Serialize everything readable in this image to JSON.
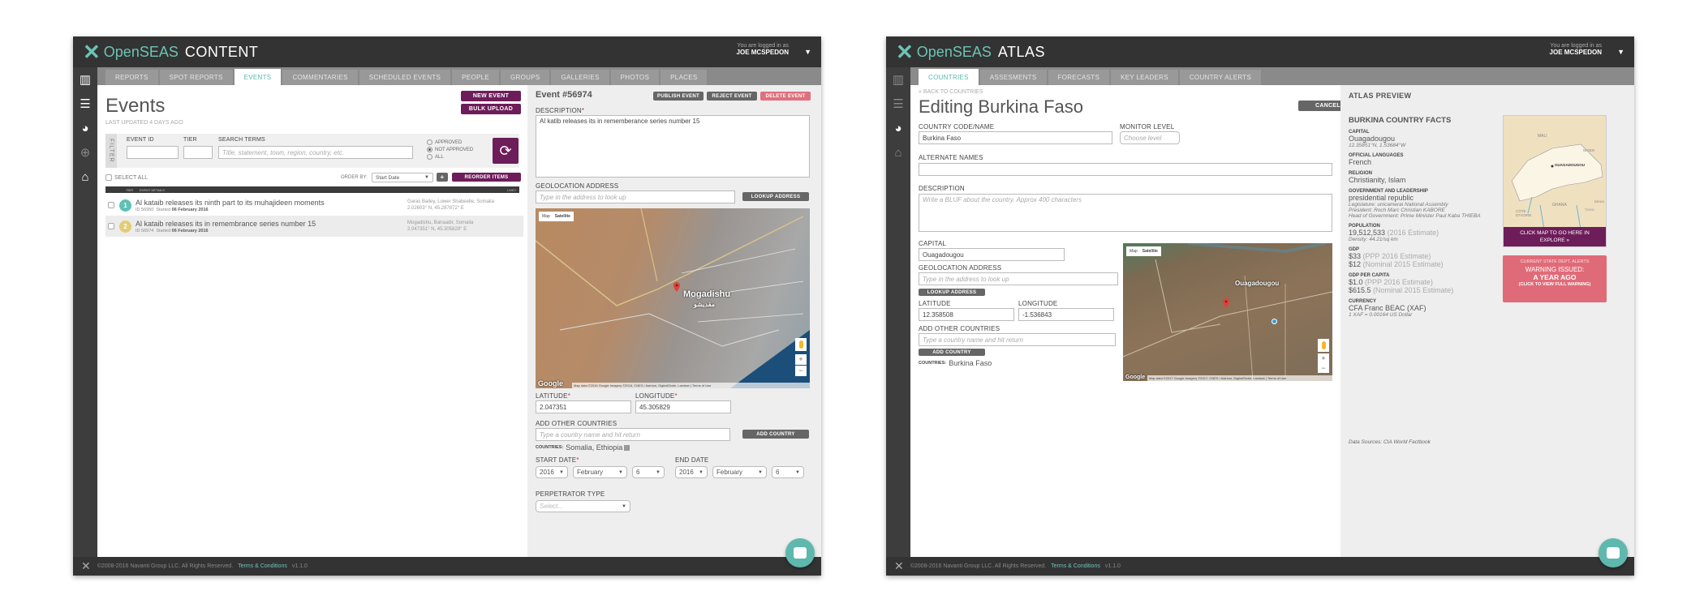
{
  "content_app": {
    "logo_brand": "OpenSEAS",
    "app_name": "CONTENT",
    "user": {
      "logged_in_label": "You are logged in as",
      "name": "JOE MCSPEDON"
    },
    "tabs": [
      "REPORTS",
      "SPOT REPORTS",
      "EVENTS",
      "COMMENTARIES",
      "SCHEDULED EVENTS",
      "PEOPLE",
      "GROUPS",
      "GALLERIES",
      "PHOTOS",
      "PLACES"
    ],
    "active_tab": "EVENTS",
    "page_title": "Events",
    "last_updated": "LAST UPDATED 4 DAYS AGO",
    "buttons": {
      "new_event": "NEW EVENT",
      "bulk_upload": "BULK UPLOAD",
      "reorder": "REORDER ITEMS",
      "plus": "+"
    },
    "filter": {
      "tab_label": "FILTER",
      "event_id_label": "EVENT ID",
      "tier_label": "TIER",
      "search_label": "SEARCH TERMS",
      "search_placeholder": "Title, statement, town, region, country, etc.",
      "radios": [
        {
          "label": "APPROVED",
          "selected": false
        },
        {
          "label": "NOT APPROVED",
          "selected": true
        },
        {
          "label": "ALL",
          "selected": false
        }
      ]
    },
    "select_all": "SELECT ALL",
    "order_by_label": "ORDER BY:",
    "order_by_value": "Start Date",
    "list_headers": {
      "tier": "TIER",
      "details": "EVENT DETAILS",
      "live": "LIVE?"
    },
    "events": [
      {
        "tier": "1",
        "tier_color": "#5fc0b4",
        "title": "Al kataib releases its ninth part to its muhajideen moments",
        "id": "ID 56950",
        "started_label": "Started",
        "started": "06 February 2016",
        "location": "Garas Balley, Lower Shabeelle, Somalia",
        "coords": "2.02603° N, 45.287872° E"
      },
      {
        "tier": "2",
        "tier_color": "#e3cc74",
        "title": "Al kataib releases its in remembrance series number 15",
        "id": "ID 56974",
        "started_label": "Started",
        "started": "06 February 2016",
        "location": "Mogadishu, Banaadir, Somalia",
        "coords": "2.047351° N, 45.305829° E"
      }
    ],
    "detail": {
      "title": "Event #56974",
      "publish": "PUBLISH EVENT",
      "reject": "REJECT EVENT",
      "delete": "DELETE EVENT",
      "description_label": "DESCRIPTION",
      "description": "Al katib releases its in rememberance series number 15",
      "geo_label": "GEOLOCATION ADDRESS",
      "geo_placeholder": "Type in the address to look up",
      "lookup": "LOOKUP ADDRESS",
      "map": {
        "tab_map": "Map",
        "tab_satellite": "Satellite",
        "city": "Mogadishu",
        "city_sub": "مقديشو",
        "attribution": "Map data ©2016 Google Imagery ©2016, CNES / Astrium, DigitalGlobe, Landsat | Terms of Use",
        "google": "Google"
      },
      "lat_label": "LATITUDE",
      "lat": "2.047351",
      "lng_label": "LONGITUDE",
      "lng": "45.305829",
      "add_countries_label": "ADD OTHER COUNTRIES",
      "add_countries_placeholder": "Type a country name and hit return",
      "add_country": "ADD COUNTRY",
      "countries_label": "COUNTRIES:",
      "countries": "Somalia, Ethiopia",
      "start_label": "START DATE",
      "end_label": "END DATE",
      "start": {
        "year": "2016",
        "month": "February",
        "day": "6"
      },
      "end": {
        "year": "2016",
        "month": "February",
        "day": "6"
      },
      "perp_label": "PERPETRATOR TYPE",
      "perp_placeholder": "Select..."
    },
    "footer": {
      "copyright": "©2008-2016 Navanti Group LLC. All Rights Reserved.",
      "terms": "Terms & Conditions",
      "version": "v1.1.0"
    }
  },
  "atlas_app": {
    "logo_brand": "OpenSEAS",
    "app_name": "ATLAS",
    "user": {
      "logged_in_label": "You are logged in as",
      "name": "JOE MCSPEDON"
    },
    "tabs": [
      "COUNTRIES",
      "ASSESMENTS",
      "FORECASTS",
      "KEY LEADERS",
      "COUNTRY ALERTS"
    ],
    "active_tab": "COUNTRIES",
    "back_link": "« BACK TO COUNTRIES",
    "page_title": "Editing Burkina Faso",
    "cancel": "CANCEL",
    "form": {
      "code_label": "COUNTRY CODE/NAME",
      "code_value": "Burkina Faso",
      "monitor_label": "MONITOR LEVEL",
      "monitor_placeholder": "Choose level",
      "alt_label": "ALTERNATE NAMES",
      "alt_value": "",
      "desc_label": "DESCRIPTION",
      "desc_placeholder": "Write a BLUF about the country. Approx 400 characters",
      "capital_label": "CAPITAL",
      "capital_value": "Ouagadougou",
      "geo_label": "GEOLOCATION ADDRESS",
      "geo_placeholder": "Type in the address to look up",
      "lookup": "LOOKUP ADDRESS",
      "lat_label": "LATITUDE",
      "lat": "12.358508",
      "lng_label": "LONGITUDE",
      "lng": "-1.536843",
      "add_countries_label": "ADD OTHER COUNTRIES",
      "add_countries_placeholder": "Type a country name and hit return",
      "add_country": "ADD COUNTRY",
      "countries_label": "COUNTRIES:",
      "countries": "Burkina Faso",
      "map": {
        "tab_map": "Map",
        "tab_satellite": "Satellite",
        "city": "Ouagadougou",
        "google": "Google",
        "attribution": "Map data ©2017 Google Imagery ©2017, CNES / Astrium, DigitalGlobe, Landsat | Terms of Use"
      }
    },
    "preview": {
      "heading": "ATLAS PREVIEW",
      "facts_title": "BURKINA COUNTRY FACTS",
      "capital_label": "CAPITAL",
      "capital": "Ouagadougou",
      "capital_coords": "12.35851°N, 1.53684°W",
      "languages_label": "OFFICIAL LANGUAGES",
      "languages": "French",
      "religion_label": "RELIGION",
      "religion": "Christianity, Islam",
      "gov_label": "GOVERNMENT AND LEADERSHIP",
      "gov": "presidential republic",
      "gov_details": [
        "Legislature: unicameral National Assembly",
        "President: Roch Marc Christian KABORE",
        "Head of Government: Prime Minister Paul Kaba THIEBA"
      ],
      "population_label": "POPULATION",
      "population": "19,512,533",
      "population_note": "(2016 Estimate)",
      "density": "Density: 44.21/sq km",
      "gdp_label": "GDP",
      "gdp": [
        {
          "value": "$33",
          "note": "(PPP 2016 Estimate)"
        },
        {
          "value": "$12",
          "note": "(Nominal 2015 Estimate)"
        }
      ],
      "gdppc_label": "GDP PER CAPITA",
      "gdppc": [
        {
          "value": "$1.0",
          "note": "(PPP 2016 Estimate)"
        },
        {
          "value": "$615.5",
          "note": "(Nominal 2015 Estimate)"
        }
      ],
      "currency_label": "CURRENCY",
      "currency": "CFA Franc BEAC (XAF)",
      "exchange": "1 XAF = 0.00164 US Dollar",
      "sources": "Data Sources: CIA World Factbook",
      "map_cta": "CLICK MAP TO GO HERE IN EXPLORE »",
      "map_labels": {
        "north": "MALI",
        "east": "NIGER",
        "south": "GHANA",
        "sw": "CÔTE D'IVOIRE",
        "capital": "OUAGADOUGOU",
        "togo": "TOGO",
        "benin": "BENIN"
      },
      "alert": {
        "title": "CURRENT STATE DEPT. ALERTS",
        "line1": "WARNING ISSUED:",
        "line2": "A YEAR AGO",
        "line3": "(CLICK TO VIEW FULL WARNING)"
      }
    },
    "footer": {
      "copyright": "©2008-2016 Navanti Group LLC. All Rights Reserved.",
      "terms": "Terms & Conditions",
      "version": "v1.1.0"
    }
  }
}
